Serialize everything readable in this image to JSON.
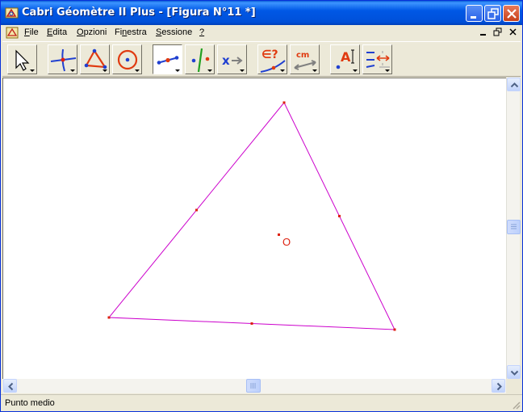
{
  "window": {
    "title": "Cabri Géomètre II Plus - [Figura N°11 *]"
  },
  "menubar": {
    "items": [
      {
        "label": "File",
        "accel": "F",
        "rest": "ile"
      },
      {
        "label": "Edita",
        "accel": "E",
        "rest": "dita"
      },
      {
        "label": "Opzioni",
        "accel": "O",
        "rest": "pzioni"
      },
      {
        "label": "Finestra",
        "pre": "Fi",
        "accel": "n",
        "rest": "estra"
      },
      {
        "label": "Sessione",
        "accel": "S",
        "rest": "essione"
      },
      {
        "label": "?",
        "accel": "?",
        "rest": ""
      }
    ]
  },
  "toolbar": {
    "tools": [
      {
        "name": "pointer-tool",
        "icon": "arrow-pointer-icon"
      },
      {
        "name": "points-tool",
        "icon": "point-intersection-icon"
      },
      {
        "name": "lines-tool",
        "icon": "triangle-icon"
      },
      {
        "name": "curves-tool",
        "icon": "circle-icon"
      },
      {
        "name": "construct-tool",
        "icon": "midpoint-icon",
        "active": true
      },
      {
        "name": "transform-tool",
        "icon": "symmetry-icon"
      },
      {
        "name": "macro-tool",
        "icon": "macro-x-icon"
      },
      {
        "name": "check-property-tool",
        "icon": "membership-icon",
        "text": "∈?"
      },
      {
        "name": "measure-tool",
        "icon": "measure-cm-icon",
        "text": "cm"
      },
      {
        "name": "display-tool",
        "icon": "label-text-icon",
        "text": "A"
      },
      {
        "name": "draw-tool",
        "icon": "mark-icon"
      }
    ]
  },
  "canvas": {
    "triangle_color": "#cc00cc",
    "point_color": "#dd2211",
    "point_label": "O"
  },
  "statusbar": {
    "text": "Punto medio"
  },
  "colors": {
    "titlebar": "#0058e6",
    "chrome": "#ece9d8",
    "canvas": "#ffffff"
  }
}
